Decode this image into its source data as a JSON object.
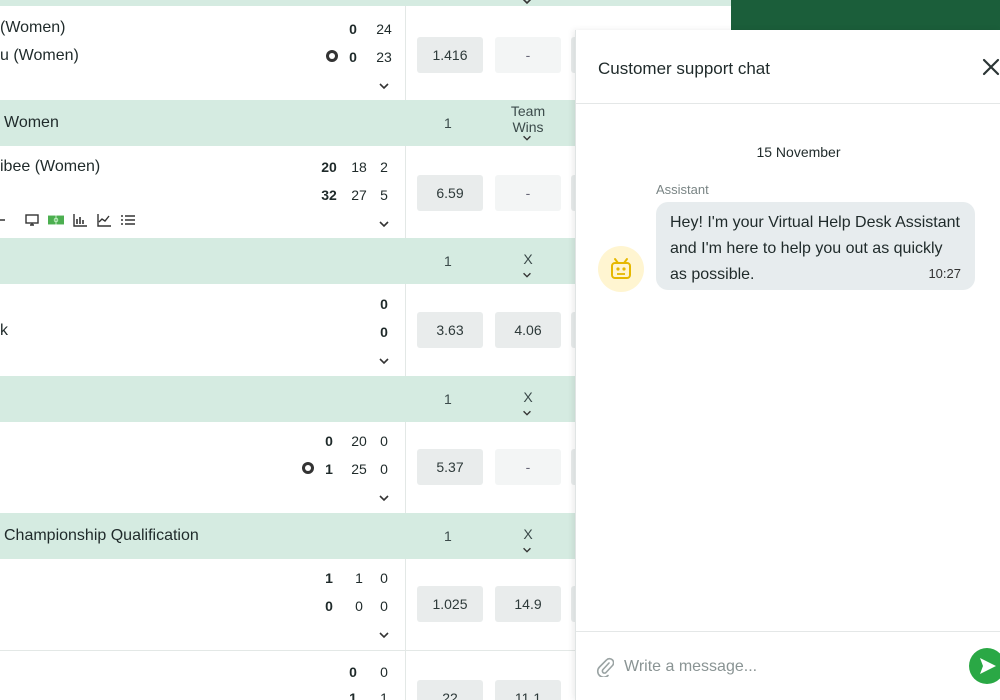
{
  "events": [
    {
      "team1": "(Women)",
      "team2": "u (Women)",
      "scores1": [
        "0",
        "24"
      ],
      "scores2": [
        "0",
        "23"
      ],
      "odds": [
        "1.416",
        "-"
      ]
    },
    {
      "header": "Women",
      "col1": "1",
      "col2_line1": "Team",
      "col2_line2": "Wins",
      "team1": "ibee (Women)",
      "scores1": [
        "20",
        "18",
        "2"
      ],
      "scores2": [
        "32",
        "27",
        "5"
      ],
      "odds": [
        "6.59",
        "-"
      ]
    },
    {
      "header": "",
      "col1": "1",
      "col2": "X",
      "team1": "k",
      "scores1": [
        "0"
      ],
      "scores2": [
        "0"
      ],
      "odds": [
        "3.63",
        "4.06"
      ]
    },
    {
      "header": "",
      "col1": "1",
      "col2": "X",
      "scores1": [
        "0",
        "20",
        "0"
      ],
      "scores2": [
        "1",
        "25",
        "0"
      ],
      "odds": [
        "5.37",
        "-"
      ]
    },
    {
      "header": "Championship Qualification",
      "col1": "1",
      "col2": "X",
      "scores1": [
        "1",
        "1",
        "0"
      ],
      "scores2": [
        "0",
        "0",
        "0"
      ],
      "odds": [
        "1.025",
        "14.9"
      ]
    },
    {
      "scores1": [
        "0",
        "0"
      ],
      "scores2": [
        "1",
        "1"
      ],
      "odds": [
        "22",
        "11.1"
      ]
    }
  ],
  "chat": {
    "title": "Customer support chat",
    "date": "15 November",
    "sender": "Assistant",
    "message": "Hey! I'm your Virtual Help Desk Assistant and I'm here to help you out as quickly as possible.",
    "time": "10:27",
    "input_placeholder": "Write a message..."
  },
  "colors": {
    "header_band": "#d5ebe1",
    "brand_green": "#1b5e3a",
    "send_button": "#2aa845",
    "bubble": "#e7ecee"
  },
  "icons": [
    "close-icon",
    "bot-avatar-icon",
    "paperclip-icon",
    "send-icon",
    "monitor-icon",
    "field-icon",
    "bar-chart-icon",
    "line-chart-icon",
    "list-icon",
    "chevron-down-icon",
    "ball-icon"
  ]
}
